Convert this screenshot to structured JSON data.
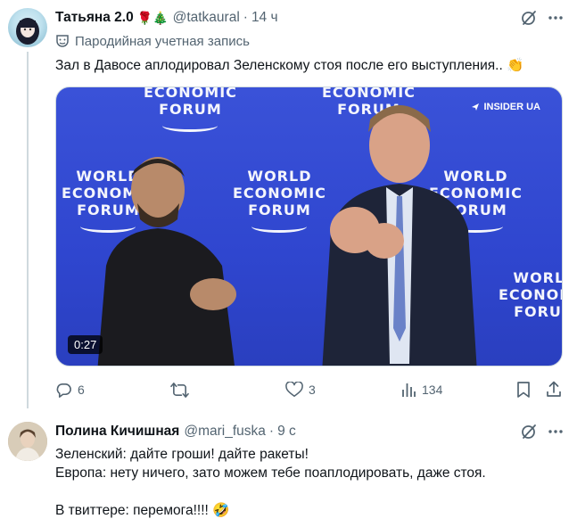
{
  "tweet": {
    "author_name": "Татьяна 2.0",
    "author_emojis": "🌹🎄",
    "author_handle": "@tatkaural",
    "separator": "·",
    "time": "14 ч",
    "parody_label": "Пародийная учетная запись",
    "text": "Зал в Давосе аплодировал Зеленскому стоя после его выступления.. 👏",
    "video": {
      "duration": "0:27",
      "watermark": "INSIDER UA",
      "backdrop_words": [
        "WORLD",
        "ECONOMIC",
        "FORUM"
      ]
    },
    "stats": {
      "replies": "6",
      "retweets": "",
      "likes": "3",
      "views": "134"
    }
  },
  "reply": {
    "author_name": "Полина Кичишная",
    "author_handle": "@mari_fuska",
    "separator": "·",
    "time": "9 с",
    "text": "Зеленский: дайте гроши! дайте ракеты!\nЕвропа: нету ничего, зато можем тебе поаплодировать, даже стоя.\n\nВ твиттере: перемога!!!! 🤣"
  },
  "colors": {
    "text_primary": "#0f1419",
    "text_secondary": "#536471",
    "divider": "#cfd9de",
    "wef_blue": "#3a52d8"
  }
}
